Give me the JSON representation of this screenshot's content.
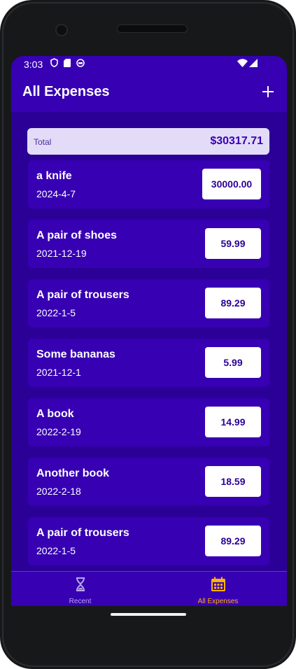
{
  "status": {
    "time": "3:03"
  },
  "appbar": {
    "title": "All Expenses",
    "add_icon": "plus-icon"
  },
  "total": {
    "label": "Total",
    "amount": "$30317.71"
  },
  "expenses": [
    {
      "title": "a knife",
      "date": "2024-4-7",
      "amount": "30000.00"
    },
    {
      "title": "A pair of shoes",
      "date": "2021-12-19",
      "amount": "59.99"
    },
    {
      "title": "A pair of trousers",
      "date": "2022-1-5",
      "amount": "89.29"
    },
    {
      "title": "Some bananas",
      "date": "2021-12-1",
      "amount": "5.99"
    },
    {
      "title": "A book",
      "date": "2022-2-19",
      "amount": "14.99"
    },
    {
      "title": "Another book",
      "date": "2022-2-18",
      "amount": "18.59"
    },
    {
      "title": "A pair of trousers",
      "date": "2022-1-5",
      "amount": "89.29"
    }
  ],
  "nav": {
    "recent": {
      "label": "Recent",
      "icon": "hourglass-icon"
    },
    "all": {
      "label": "All Expenses",
      "icon": "calendar-icon"
    },
    "active": "all"
  },
  "colors": {
    "primary": "#3700b3",
    "background": "#2b0096",
    "active_nav": "#ffb300",
    "inactive_nav": "#b9a6e8"
  }
}
